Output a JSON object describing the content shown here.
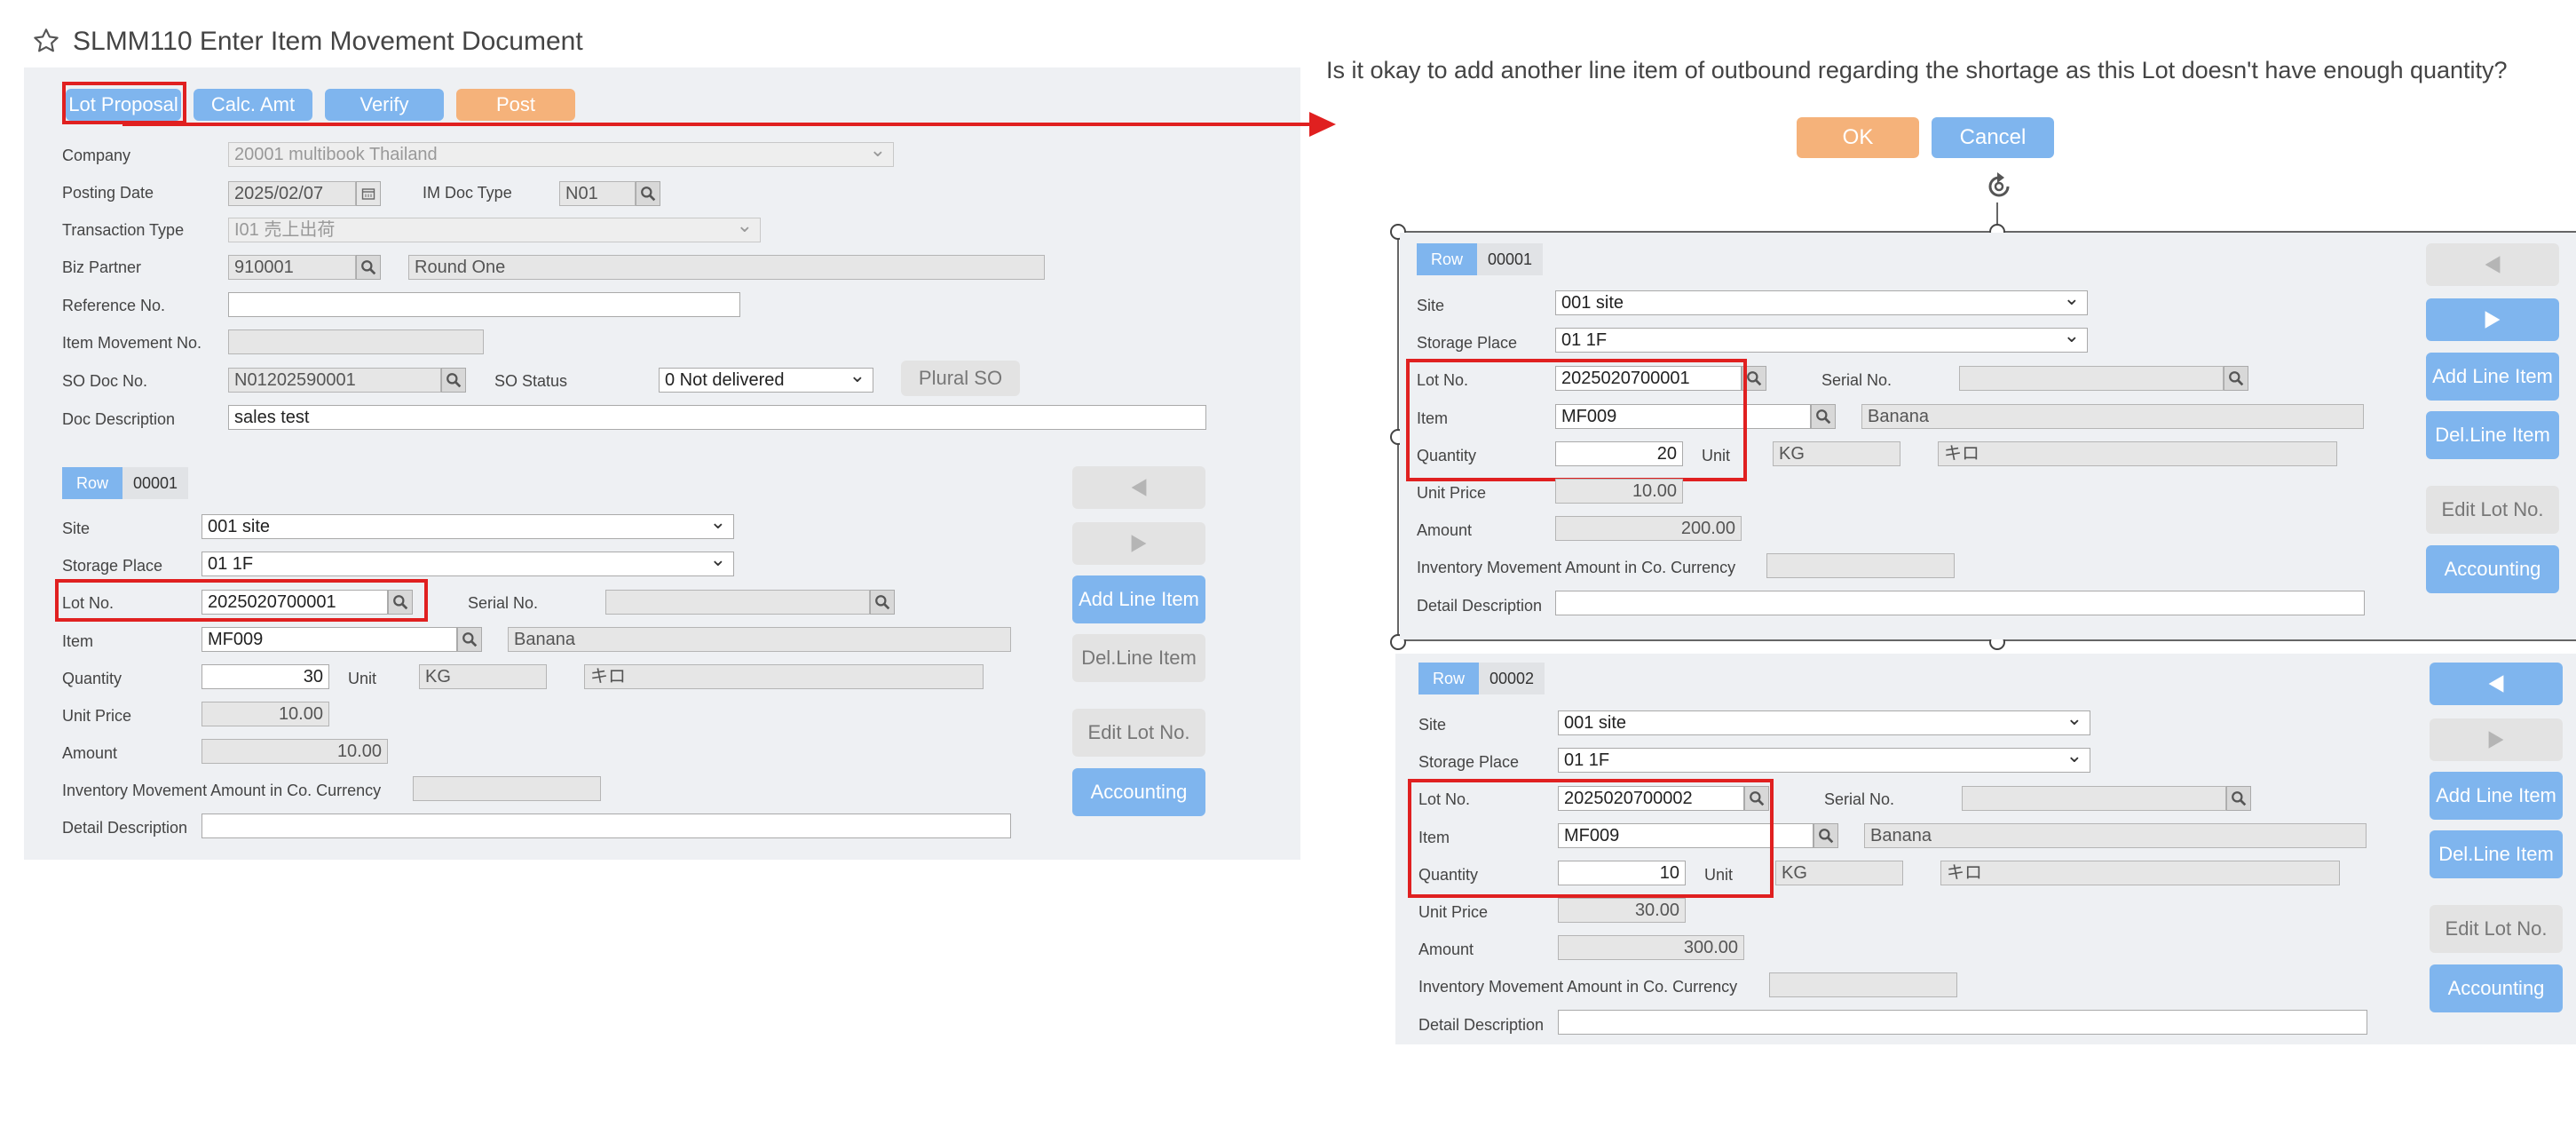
{
  "header": {
    "title": "SLMM110 Enter Item Movement Document"
  },
  "toolbar": {
    "lot_proposal": "Lot Proposal",
    "calc_amt": "Calc. Amt",
    "verify": "Verify",
    "post": "Post"
  },
  "form": {
    "company_label": "Company",
    "company_value": "20001 multibook Thailand",
    "posting_date_label": "Posting Date",
    "posting_date_value": "2025/02/07",
    "im_doc_type_label": "IM Doc Type",
    "im_doc_type_value": "N01",
    "transaction_type_label": "Transaction Type",
    "transaction_type_value": "I01 売上出荷",
    "biz_partner_label": "Biz Partner",
    "biz_partner_code": "910001",
    "biz_partner_name": "Round One",
    "reference_no_label": "Reference No.",
    "reference_no_value": "",
    "item_movement_no_label": "Item Movement No.",
    "item_movement_no_value": "",
    "so_doc_no_label": "SO Doc No.",
    "so_doc_no_value": "N01202590001",
    "so_status_label": "SO Status",
    "so_status_value": "0 Not delivered",
    "plural_so": "Plural SO",
    "doc_description_label": "Doc Description",
    "doc_description_value": "sales test"
  },
  "labels": {
    "row": "Row",
    "site": "Site",
    "storage_place": "Storage Place",
    "lot_no": "Lot No.",
    "serial_no": "Serial No.",
    "item": "Item",
    "quantity": "Quantity",
    "unit": "Unit",
    "unit_price": "Unit Price",
    "amount": "Amount",
    "inv_amount": "Inventory Movement Amount in Co. Currency",
    "detail_description": "Detail Description"
  },
  "side_buttons": {
    "add_line": "Add Line Item",
    "del_line": "Del.Line Item",
    "edit_lot": "Edit Lot No.",
    "accounting": "Accounting"
  },
  "main_line": {
    "row_no": "00001",
    "site": "001 site",
    "storage_place": "01 1F",
    "lot_no": "2025020700001",
    "serial_no": "",
    "item_code": "MF009",
    "item_name": "Banana",
    "quantity": "30",
    "unit_code": "KG",
    "unit_name": "キロ",
    "unit_price": "10.00",
    "amount": "10.00",
    "inv_amount": "",
    "detail": ""
  },
  "dialog": {
    "message": "Is it okay to add another line item of outbound regarding the shortage as this Lot doesn't have enough quantity?",
    "ok": "OK",
    "cancel": "Cancel"
  },
  "result_lines": [
    {
      "row_no": "00001",
      "site": "001 site",
      "storage_place": "01 1F",
      "lot_no": "2025020700001",
      "serial_no": "",
      "item_code": "MF009",
      "item_name": "Banana",
      "quantity": "20",
      "unit_code": "KG",
      "unit_name": "キロ",
      "unit_price": "10.00",
      "amount": "200.00",
      "inv_amount": "",
      "detail": ""
    },
    {
      "row_no": "00002",
      "site": "001 site",
      "storage_place": "01 1F",
      "lot_no": "2025020700002",
      "serial_no": "",
      "item_code": "MF009",
      "item_name": "Banana",
      "quantity": "10",
      "unit_code": "KG",
      "unit_name": "キロ",
      "unit_price": "30.00",
      "amount": "300.00",
      "inv_amount": "",
      "detail": ""
    }
  ],
  "colors": {
    "accent_blue": "#7fb5ee",
    "post_orange": "#f5b27a",
    "annotation_red": "#e02020",
    "panel_bg": "#eef0f3"
  }
}
